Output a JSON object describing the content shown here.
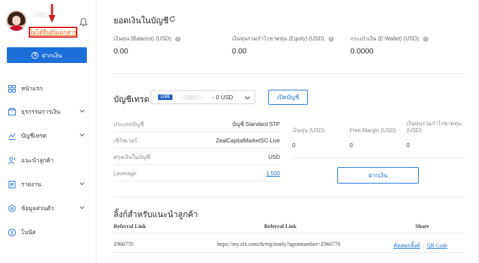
{
  "sidebar": {
    "verify_link": "ไม่ได้ยืนยันเอกสาร",
    "deposit_button": "ฝากเงิน",
    "items": [
      {
        "label": "หน้าแรก",
        "icon": "dashboard-icon",
        "expandable": false
      },
      {
        "label": "ธุรกรรมการเงิน",
        "icon": "wallet-icon",
        "expandable": true
      },
      {
        "label": "บัญชีเทรด",
        "icon": "chart-icon",
        "expandable": true
      },
      {
        "label": "แนะนำลูกค้า",
        "icon": "user-plus-icon",
        "expandable": false
      },
      {
        "label": "รายงาน",
        "icon": "report-icon",
        "expandable": true
      },
      {
        "label": "ข้อมูลส่วนตัว",
        "icon": "settings-icon",
        "expandable": true
      },
      {
        "label": "โบนัส",
        "icon": "bonus-icon",
        "expandable": false
      }
    ]
  },
  "balance": {
    "title": "ยอดเงินในบัญชี",
    "items": [
      {
        "label": "เงินทุน (Balance) (USD):",
        "value": "0.00"
      },
      {
        "label": "เงินทุนรวมกำไรขาดทุน (Equity) (USD):",
        "value": "0.00"
      },
      {
        "label": "กระเป๋าเงิน (E-Wallet) (USD):",
        "value": "0.0000"
      }
    ]
  },
  "trading": {
    "title": "บัญชีเทรด",
    "live_badge": "LIVE",
    "account_suffix": "- 0 USD",
    "open_button": "เปิดบัญชี",
    "info": [
      {
        "key": "ประเภทบัญชี",
        "value": "บัญชี Standard STP"
      },
      {
        "key": "เซิร์ฟเวอร์",
        "value": "ZealCapitalMarketSC-Live"
      },
      {
        "key": "สกุลเงินในบัญชี",
        "value": "USD"
      },
      {
        "key": "Leverage",
        "value": "1:500"
      }
    ],
    "stats": [
      {
        "label": "เงินทุน (USD)",
        "value": "0"
      },
      {
        "label": "Free Margin (USD)",
        "value": "0"
      },
      {
        "label": "เงินทุนรวมกำไรขาดทุน (USD)",
        "value": "0"
      }
    ],
    "deposit_button": "ฝากเงิน"
  },
  "referral": {
    "title": "ลิ้งก์สำหรับแนะนำลูกค้า",
    "headers": [
      "Referral Link",
      "Referral Link",
      "Share"
    ],
    "row": {
      "code": "Z966770",
      "url": "https://my.zfx.com/th/reg/truely?agentnumber=Z966770",
      "copy": "คัดลอกลิ้งค์",
      "qr": "QR Code"
    }
  }
}
